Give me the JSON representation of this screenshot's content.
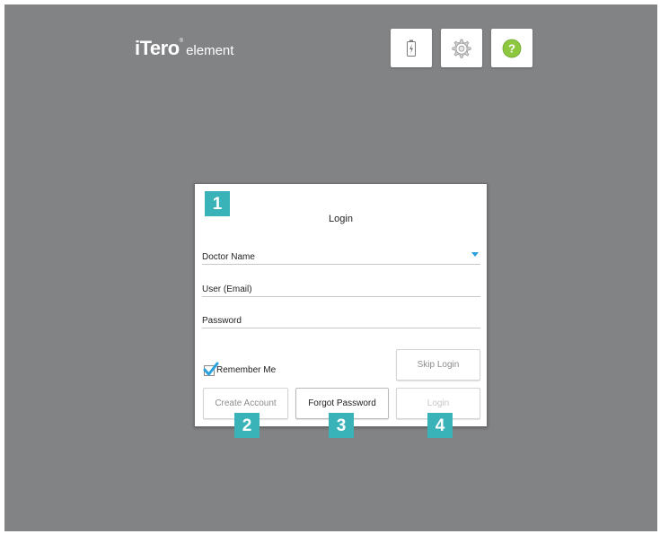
{
  "app": {
    "logo_brand": "iTero",
    "logo_reg": "®",
    "logo_sub": "element"
  },
  "toolbar": {
    "battery_icon": "battery-charging-icon",
    "settings_icon": "gear-icon",
    "help_icon": "help-icon",
    "help_color": "#8dc63f"
  },
  "login": {
    "title": "Login",
    "fields": {
      "doctor_name": "Doctor Name",
      "user_email": "User (Email)",
      "password": "Password"
    },
    "remember_me": "Remember Me",
    "remember_checked": true,
    "skip_login": "Skip Login",
    "create_account": "Create Account",
    "forgot_password": "Forgot Password",
    "login_button": "Login"
  },
  "callouts": [
    "1",
    "2",
    "3",
    "4"
  ],
  "colors": {
    "background": "#828385",
    "callout": "#3ab3b8",
    "accent": "#2aa0dd"
  }
}
